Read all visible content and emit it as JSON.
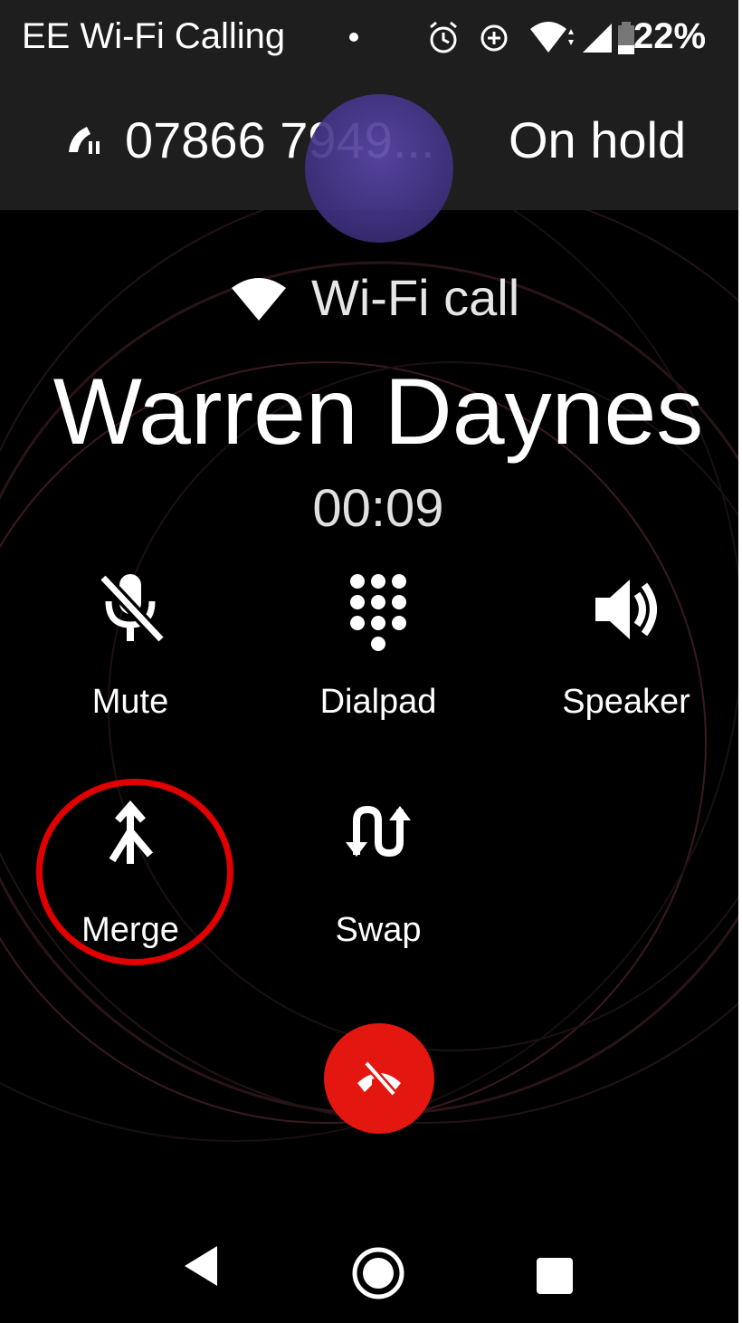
{
  "status_bar": {
    "carrier": "EE Wi-Fi Calling",
    "battery": "22%",
    "icons": [
      "dot-icon",
      "alarm-icon",
      "data-saver-icon",
      "wifi-signal-icon",
      "cellular-signal-icon",
      "battery-icon"
    ]
  },
  "held_call": {
    "number": "07866 7949...",
    "status": "On hold",
    "icon": "call-hold-icon"
  },
  "active_call": {
    "call_type": "Wi-Fi call",
    "caller_name": "Warren Daynes",
    "duration": "00:09"
  },
  "controls": [
    {
      "label": "Mute",
      "icon": "mic-off-icon"
    },
    {
      "label": "Dialpad",
      "icon": "dialpad-icon"
    },
    {
      "label": "Speaker",
      "icon": "speaker-icon"
    },
    {
      "label": "Merge",
      "icon": "merge-icon"
    },
    {
      "label": "Swap",
      "icon": "swap-icon"
    }
  ],
  "end_call": {
    "icon": "end-call-icon"
  },
  "nav": {
    "icons": [
      "back-icon",
      "home-icon",
      "recents-icon"
    ]
  },
  "colors": {
    "background": "#000000",
    "status_bar": "#1e1e1e",
    "end_call": "#e3170f",
    "highlight": "#e00000",
    "avatar": "#4b3b95"
  }
}
